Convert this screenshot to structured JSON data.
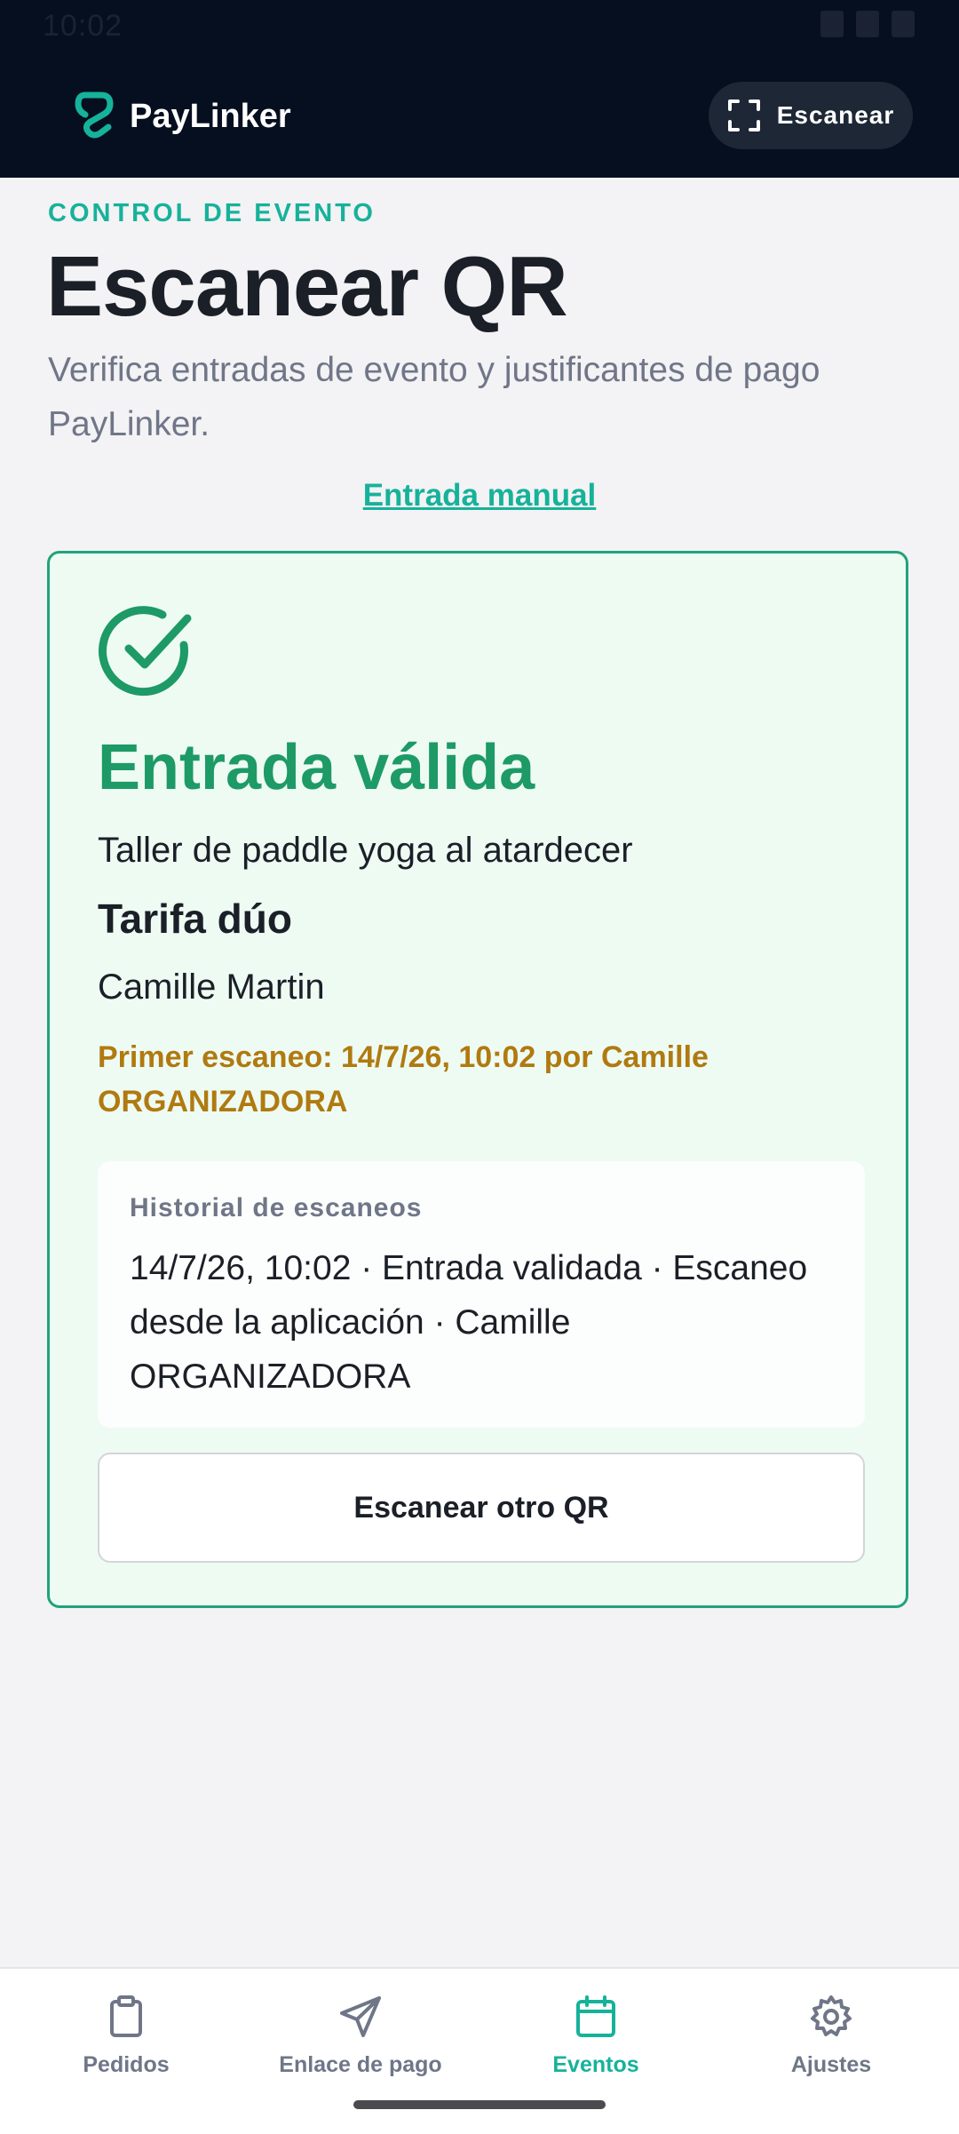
{
  "status_bar": {
    "time": "10:02"
  },
  "header": {
    "brand": "PayLinker",
    "scan_button": "Escanear"
  },
  "page": {
    "kicker": "CONTROL DE EVENTO",
    "title": "Escanear QR",
    "subtitle": "Verifica entradas de evento y justificantes de pago PayLinker.",
    "manual_link": "Entrada manual"
  },
  "result": {
    "status": "Entrada válida",
    "event_name": "Taller de paddle yoga al atardecer",
    "tariff": "Tarifa dúo",
    "holder": "Camille Martin",
    "first_scan": "Primer escaneo: 14/7/26, 10:02 por Camille ORGANIZADORA",
    "history_title": "Historial de escaneos",
    "history_entry": "14/7/26, 10:02 · Entrada validada · Escaneo desde la aplicación · Camille ORGANIZADORA",
    "scan_other_button": "Escanear otro QR"
  },
  "bottom_nav": {
    "items": [
      {
        "label": "Pedidos",
        "icon": "clipboard-icon",
        "active": false
      },
      {
        "label": "Enlace de pago",
        "icon": "send-icon",
        "active": false
      },
      {
        "label": "Eventos",
        "icon": "calendar-icon",
        "active": true
      },
      {
        "label": "Ajustes",
        "icon": "gear-icon",
        "active": false
      }
    ]
  },
  "colors": {
    "header_bg": "#060f1f",
    "accent": "#16b29a",
    "success": "#1d9a66",
    "warning": "#b07a10",
    "page_bg": "#f3f2f4"
  }
}
